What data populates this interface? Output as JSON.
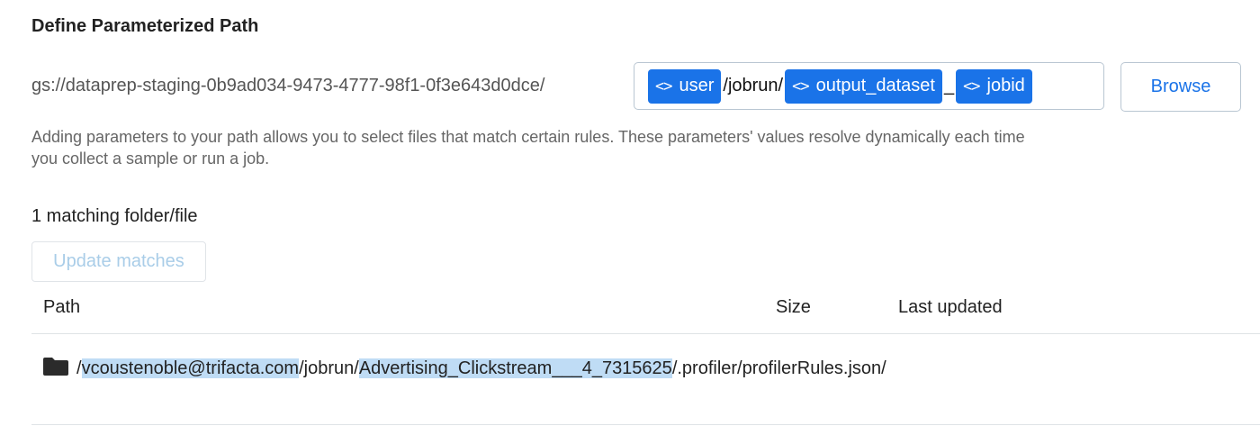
{
  "title": "Define Parameterized Path",
  "path_prefix": "gs://dataprep-staging-0b9ad034-9473-4777-98f1-0f3e643d0dce/",
  "path_builder": {
    "token_icon": "<>",
    "user_token": "user",
    "literal_1": "/jobrun/",
    "dataset_token": "output_dataset",
    "literal_2": "_",
    "jobid_token": "jobid"
  },
  "browse_label": "Browse",
  "helper_text": "Adding parameters to your path allows you to select files that match certain rules. These parameters' values resolve dynamically each time you collect a sample or run a job.",
  "match_count_text": "1 matching folder/file",
  "update_matches_label": "Update matches",
  "table": {
    "columns": {
      "path": "Path",
      "size": "Size",
      "last_updated": "Last updated"
    },
    "rows": [
      {
        "icon": "folder-icon",
        "path_parts": {
          "sep1": "/",
          "user": "vcoustenoble@trifacta.com",
          "mid": "/jobrun/",
          "dataset_job": "Advertising_Clickstream___4_7315625",
          "tail": "/.profiler/profilerRules.json/"
        },
        "size": "",
        "last_updated": ""
      }
    ]
  },
  "colors": {
    "accent": "#1a73e8",
    "highlight": "#bfdcf5",
    "disabled_text": "#a9cde8"
  }
}
